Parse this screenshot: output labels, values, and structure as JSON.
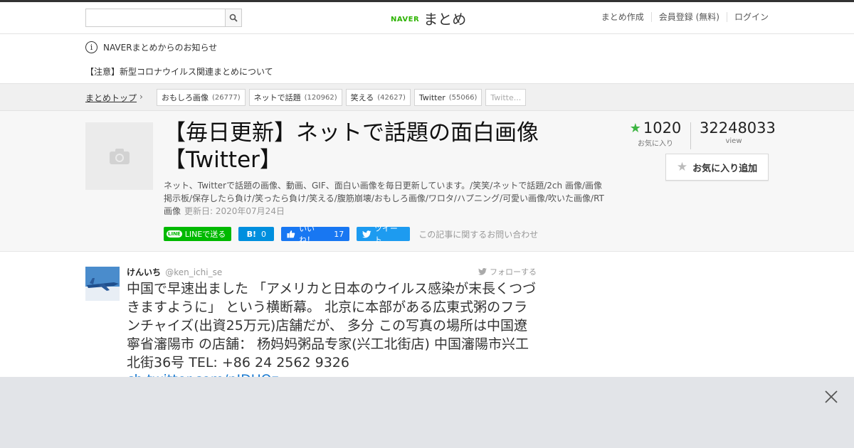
{
  "header": {
    "logo_naver": "NAVER",
    "logo_matome": "まとめ",
    "search_value": "",
    "nav": [
      "まとめ作成",
      "会員登録 (無料)",
      "ログイン"
    ]
  },
  "notice": {
    "title": "NAVERまとめからのお知らせ",
    "item": "【注意】新型コロナウイルス関連まとめについて"
  },
  "breadcrumb": {
    "top": "まとめトップ",
    "tags": [
      {
        "label": "おもしろ画像",
        "count": "(26777)"
      },
      {
        "label": "ネットで話題",
        "count": "(120962)"
      },
      {
        "label": "笑える",
        "count": "(42627)"
      },
      {
        "label": "Twitter",
        "count": "(55066)"
      },
      {
        "label": "Twitte...",
        "count": ""
      }
    ]
  },
  "article": {
    "title": "【毎日更新】ネットで話題の面白画像【Twitter】",
    "description": "ネット、Twitterで話題の画像、動画、GIF、面白い画像を毎日更新しています。/笑笑/ネットで話題/2ch 画像/画像掲示板/保存したら負け/笑ったら負け/笑える/腹筋崩壊/おもしろ画像/ワロタ/ハプニング/可愛い画像/吹いた画像/RT画像",
    "updated": "更新日: 2020年07月24日",
    "share": {
      "line": "LINEで送る",
      "line_icon": "LINE",
      "hatena": "0",
      "hatena_icon": "B!",
      "fb_like": "いいね！",
      "fb_count": "17",
      "tweet": "ツイート",
      "inquiry": "この記事に関するお問い合わせ"
    },
    "fav_count": "1020",
    "fav_label": "お気に入り",
    "view_count": "32248033",
    "view_label": "view",
    "fav_button": "お気に入り追加"
  },
  "tweet": {
    "name": "けんいち",
    "handle": "@ken_ichi_se",
    "follow": "フォローする",
    "text": "中国で早速出ました 「アメリカと日本のウイルス感染が末長くつづきますように」 という横断幕。 北京に本部がある広東式粥のフランチャイズ(出資25万元)店舗だが、 多分 この写真の場所は中国遼寧省瀋陽市 の店舗： 杨妈妈粥品专家(兴工北街店) 中国瀋陽市兴工北街36号 TEL: +86 24 2562 9326",
    "link": "ch.twitter.com/nIDUOz..."
  },
  "colors": {
    "naver_green": "#2db400",
    "line_green": "#00b900",
    "hatena_blue": "#008fde",
    "fb_blue": "#1877f2",
    "twitter_blue": "#1d9bf0",
    "fav_star": "#3db542"
  }
}
